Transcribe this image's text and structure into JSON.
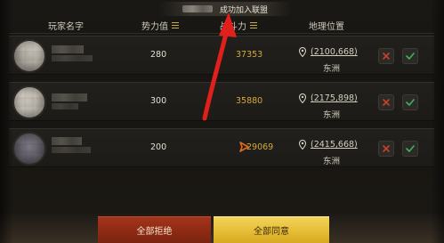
{
  "toast": {
    "message": "成功加入联盟"
  },
  "header": {
    "player_name": "玩家名字",
    "power": "势力值",
    "might": "战斗力",
    "location": "地理位置"
  },
  "rows": [
    {
      "power": "280",
      "might": "37353",
      "coord": "(2100,668)",
      "region": "东洲"
    },
    {
      "power": "300",
      "might": "35880",
      "coord": "(2175,898)",
      "region": "东洲"
    },
    {
      "power": "200",
      "might": "29069",
      "coord": "(2415,668)",
      "region": "东洲"
    }
  ],
  "buttons": {
    "reject_all": "全部拒绝",
    "accept_all": "全部同意"
  },
  "icons": {
    "sort": "sort-icon",
    "location": "map-pin-icon",
    "reject": "close-icon",
    "accept": "check-icon",
    "cursor": "triangle-cursor-icon"
  },
  "colors": {
    "might_value": "#d4a83c",
    "reject_icon": "#c8412d",
    "accept_icon": "#3fae5a",
    "reject_button": "#9a2f18",
    "accept_button": "#e6bd36",
    "annotation_arrow": "#e0201b"
  }
}
